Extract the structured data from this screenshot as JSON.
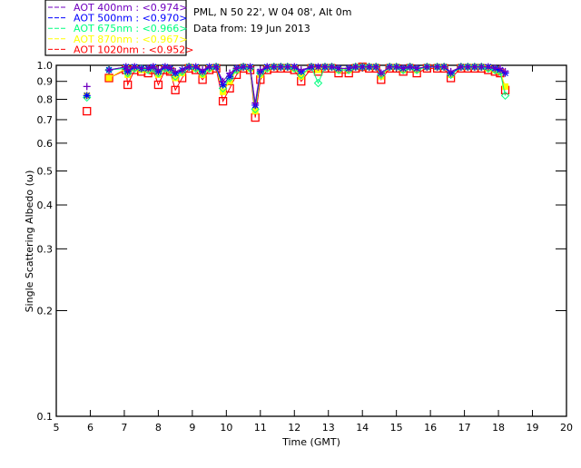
{
  "header": {
    "location": "PML, N 50 22', W 04 08', Alt 0m",
    "date": "Data from: 19 Jun 2013"
  },
  "chart_data": {
    "type": "line",
    "title": "",
    "xlabel": "Time (GMT)",
    "ylabel": "Single Scattering Albedo (ω)",
    "xlim": [
      5,
      20
    ],
    "ylim": [
      0.1,
      1.0
    ],
    "yscale": "log",
    "grid": false,
    "legend_position": "top-left",
    "x_ticks": [
      "5",
      "6",
      "7",
      "8",
      "9",
      "10",
      "11",
      "12",
      "13",
      "14",
      "15",
      "16",
      "17",
      "18",
      "19",
      "20"
    ],
    "y_ticks": [
      "0.1",
      "0.2",
      "0.3",
      "0.4",
      "0.5",
      "0.6",
      "0.7",
      "0.8",
      "0.9",
      "1.0"
    ],
    "x": [
      5.9,
      6.55,
      7.05,
      7.1,
      7.3,
      7.5,
      7.7,
      7.85,
      8.0,
      8.2,
      8.35,
      8.5,
      8.7,
      8.9,
      9.1,
      9.3,
      9.5,
      9.7,
      9.9,
      10.1,
      10.3,
      10.5,
      10.7,
      10.85,
      11.0,
      11.2,
      11.4,
      11.6,
      11.8,
      12.0,
      12.2,
      12.5,
      12.7,
      12.9,
      13.1,
      13.3,
      13.6,
      13.8,
      14.0,
      14.2,
      14.4,
      14.55,
      14.8,
      15.0,
      15.2,
      15.4,
      15.6,
      15.9,
      16.2,
      16.4,
      16.6,
      16.9,
      17.1,
      17.3,
      17.5,
      17.7,
      17.9,
      18.05,
      18.2
    ],
    "series": [
      {
        "name": "AOT  400nm : <0.974>",
        "color": "#7000c0",
        "marker": "plus",
        "values": [
          0.87,
          0.97,
          0.99,
          0.97,
          0.99,
          0.98,
          0.98,
          0.99,
          0.97,
          0.99,
          0.98,
          0.96,
          0.97,
          0.99,
          0.99,
          0.97,
          0.99,
          0.99,
          0.9,
          0.95,
          0.98,
          0.99,
          0.99,
          0.78,
          0.97,
          0.99,
          0.99,
          0.99,
          0.99,
          0.99,
          0.97,
          0.99,
          0.99,
          0.99,
          0.99,
          0.98,
          0.98,
          0.99,
          0.99,
          0.99,
          0.99,
          0.95,
          0.99,
          0.99,
          0.98,
          0.99,
          0.98,
          0.99,
          0.99,
          0.99,
          0.96,
          0.99,
          0.99,
          0.99,
          0.99,
          0.99,
          0.98,
          0.98,
          0.96
        ]
      },
      {
        "name": "AOT  500nm : <0.970>",
        "color": "#0000ff",
        "marker": "asterisk",
        "values": [
          0.82,
          0.97,
          0.99,
          0.96,
          0.99,
          0.98,
          0.98,
          0.99,
          0.96,
          0.99,
          0.98,
          0.95,
          0.97,
          0.99,
          0.99,
          0.96,
          0.99,
          0.99,
          0.88,
          0.93,
          0.98,
          0.99,
          0.99,
          0.77,
          0.96,
          0.99,
          0.99,
          0.99,
          0.99,
          0.99,
          0.96,
          0.99,
          0.99,
          0.99,
          0.99,
          0.98,
          0.98,
          0.99,
          0.99,
          0.99,
          0.99,
          0.95,
          0.99,
          0.99,
          0.98,
          0.99,
          0.98,
          0.99,
          0.99,
          0.99,
          0.95,
          0.99,
          0.99,
          0.99,
          0.99,
          0.99,
          0.98,
          0.97,
          0.95
        ]
      },
      {
        "name": "AOT  675nm : <0.966>",
        "color": "#00ff80",
        "marker": "diamond",
        "values": [
          0.81,
          0.97,
          0.98,
          0.95,
          0.98,
          0.98,
          0.97,
          0.98,
          0.95,
          0.98,
          0.97,
          0.93,
          0.96,
          0.99,
          0.98,
          0.95,
          0.98,
          0.99,
          0.86,
          0.92,
          0.97,
          0.99,
          0.98,
          0.75,
          0.95,
          0.98,
          0.99,
          0.99,
          0.99,
          0.98,
          0.94,
          0.99,
          0.89,
          0.99,
          0.99,
          0.97,
          0.97,
          0.99,
          0.99,
          0.99,
          0.99,
          0.94,
          0.99,
          0.99,
          0.97,
          0.99,
          0.97,
          0.99,
          0.99,
          0.99,
          0.94,
          0.99,
          0.99,
          0.99,
          0.99,
          0.98,
          0.97,
          0.96,
          0.82
        ]
      },
      {
        "name": "AOT  870nm : <0.967>",
        "color": "#ffff00",
        "marker": "square-filled",
        "values": [
          0.82,
          0.92,
          0.98,
          0.94,
          0.98,
          0.97,
          0.97,
          0.98,
          0.94,
          0.98,
          0.97,
          0.92,
          0.95,
          0.99,
          0.98,
          0.94,
          0.98,
          0.99,
          0.84,
          0.9,
          0.97,
          0.99,
          0.98,
          0.74,
          0.94,
          0.98,
          0.99,
          0.99,
          0.99,
          0.98,
          0.93,
          0.99,
          0.97,
          0.99,
          0.99,
          0.97,
          0.97,
          0.99,
          0.99,
          0.99,
          0.99,
          0.93,
          0.99,
          0.99,
          0.97,
          0.99,
          0.97,
          0.99,
          0.99,
          0.99,
          0.94,
          0.99,
          0.99,
          0.99,
          0.99,
          0.98,
          0.97,
          0.96,
          0.87
        ]
      },
      {
        "name": "AOT 1020nm : <0.952>",
        "color": "#ff0000",
        "marker": "square-open",
        "values": [
          0.74,
          0.92,
          0.97,
          0.88,
          0.97,
          0.96,
          0.95,
          0.97,
          0.88,
          0.97,
          0.96,
          0.85,
          0.92,
          0.98,
          0.97,
          0.91,
          0.97,
          0.98,
          0.79,
          0.86,
          0.94,
          0.98,
          0.97,
          0.71,
          0.91,
          0.97,
          0.98,
          0.98,
          0.98,
          0.97,
          0.9,
          0.98,
          0.96,
          0.98,
          0.98,
          0.95,
          0.95,
          0.98,
          0.99,
          0.98,
          0.98,
          0.91,
          0.98,
          0.98,
          0.96,
          0.98,
          0.95,
          0.98,
          0.98,
          0.98,
          0.92,
          0.98,
          0.98,
          0.98,
          0.98,
          0.97,
          0.96,
          0.95,
          0.85
        ]
      }
    ]
  }
}
